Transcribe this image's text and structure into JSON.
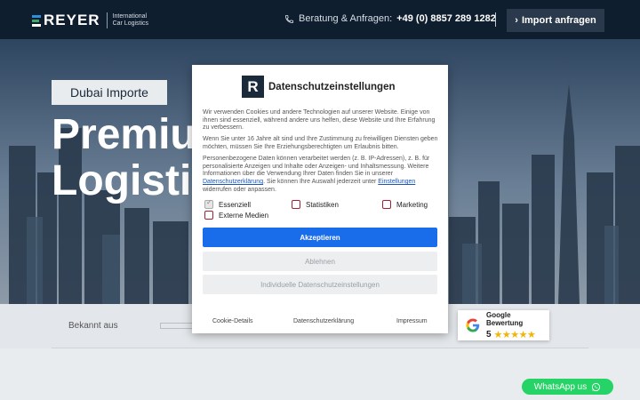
{
  "header": {
    "logo_word": "REYER",
    "logo_sub_line1": "International",
    "logo_sub_line2": "Car Logistics",
    "contact_label": "Beratung & Anfragen:",
    "contact_phone": "+49 (0) 8857 289 1282",
    "import_button": "Import anfragen",
    "import_chevron": "›"
  },
  "hero": {
    "tag": "Dubai Importe",
    "title_line1": "Premium",
    "title_line2": "Logistik"
  },
  "band": {
    "label": "Bekannt aus"
  },
  "google_badge": {
    "title": "Google Bewertung",
    "score": "5",
    "stars": "★★★★★"
  },
  "whatsapp": {
    "label": "WhatsApp us"
  },
  "cookie_modal": {
    "logo_letter": "R",
    "title": "Datenschutzeinstellungen",
    "p1": "Wir verwenden Cookies und andere Technologien auf unserer Website. Einige von ihnen sind essenziell, während andere uns helfen, diese Website und Ihre Erfahrung zu verbessern.",
    "p2": "Wenn Sie unter 16 Jahre alt sind und Ihre Zustimmung zu freiwilligen Diensten geben möchten, müssen Sie Ihre Erziehungsberechtigten um Erlaubnis bitten.",
    "p3_part1": "Personenbezogene Daten können verarbeitet werden (z. B. IP-Adressen), z. B. für personalisierte Anzeigen und Inhalte oder Anzeigen- und Inhaltsmessung. Weitere Informationen über die Verwendung Ihrer Daten finden Sie in unserer ",
    "p3_link1": "Datenschutzerklärung",
    "p3_part2": ". Sie können Ihre Auswahl jederzeit unter ",
    "p3_link2": "Einstellungen",
    "p3_part3": " widerrufen oder anpassen.",
    "options": {
      "essential": "Essenziell",
      "statistics": "Statistiken",
      "marketing": "Marketing",
      "external": "Externe Medien"
    },
    "accept_button": "Akzeptieren",
    "decline_button": "Ablehnen",
    "individual_button": "Individuelle Datenschutzeinstellungen",
    "footer": {
      "cookie_details": "Cookie-Details",
      "privacy": "Datenschutzerklärung",
      "imprint": "Impressum"
    }
  },
  "colors": {
    "header_bg": "#0f1e2e",
    "accept_blue": "#1a6dea",
    "checkbox_red": "#9b2335",
    "whatsapp_green": "#25d366",
    "star_yellow": "#f4b400"
  }
}
